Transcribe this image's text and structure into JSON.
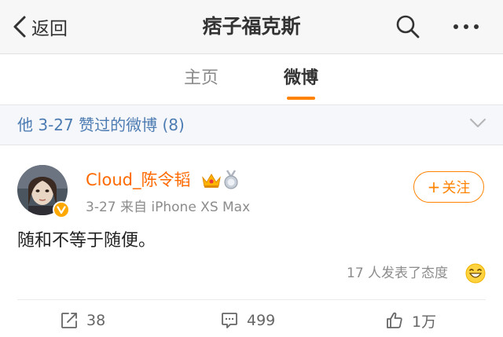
{
  "nav": {
    "back_label": "返回",
    "title": "痞子福克斯"
  },
  "tabs": [
    {
      "label": "主页",
      "active": false
    },
    {
      "label": "微博",
      "active": true
    }
  ],
  "liked_bar": {
    "text": "他 3-27 赞过的微博 (8)"
  },
  "post": {
    "username": "Cloud_陈令韬",
    "meta": "3-27  来自 iPhone XS Max",
    "follow_label": "关注",
    "follow_plus": "+",
    "text": "随和不等于随便。",
    "reactions": "17 人发表了态度",
    "verified": true
  },
  "actions": {
    "repost_count": "38",
    "comment_count": "499",
    "like_count": "1万"
  },
  "colors": {
    "accent": "#ff8200",
    "username": "#ff6a00",
    "link_blue": "#4d7cb3",
    "verified_badge": "#ffa800"
  }
}
